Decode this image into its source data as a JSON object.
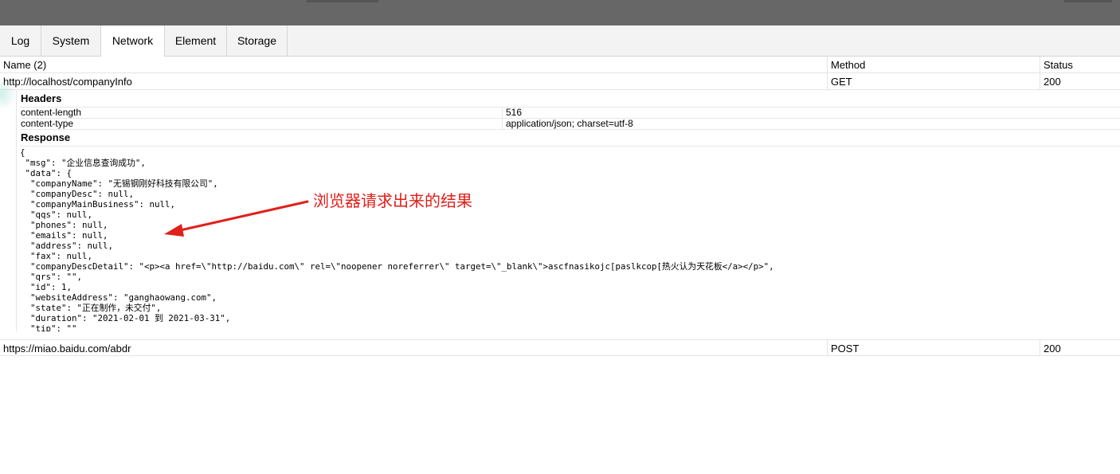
{
  "tabs": [
    {
      "label": "Log"
    },
    {
      "label": "System"
    },
    {
      "label": "Network"
    },
    {
      "label": "Element"
    },
    {
      "label": "Storage"
    }
  ],
  "active_tab": "Network",
  "columns": {
    "name": "Name (2)",
    "method": "Method",
    "status": "Status"
  },
  "requests": [
    {
      "url": "http://localhost/companyInfo",
      "method": "GET",
      "status": "200"
    },
    {
      "url": "https://miao.baidu.com/abdr",
      "method": "POST",
      "status": "200"
    }
  ],
  "details": {
    "headers_title": "Headers",
    "headers": [
      {
        "key": "content-length",
        "value": "516"
      },
      {
        "key": "content-type",
        "value": "application/json; charset=utf-8"
      }
    ],
    "response_title": "Response",
    "response_body": "{\n \"msg\": \"企业信息查询成功\",\n \"data\": {\n  \"companyName\": \"无锡钢刚好科技有限公司\",\n  \"companyDesc\": null,\n  \"companyMainBusiness\": null,\n  \"qqs\": null,\n  \"phones\": null,\n  \"emails\": null,\n  \"address\": null,\n  \"fax\": null,\n  \"companyDescDetail\": \"<p><a href=\\\"http://baidu.com\\\" rel=\\\"noopener noreferrer\\\" target=\\\"_blank\\\">ascfnasikojc[paslkcop[热火认为天花板</a></p>\",\n  \"qrs\": \"\",\n  \"id\": 1,\n  \"websiteAddress\": \"ganghaowang.com\",\n  \"state\": \"正在制作，未交付\",\n  \"duration\": \"2021-02-01 到 2021-03-31\",\n  \"tip\": \"\""
  },
  "annotation": {
    "text": "浏览器请求出来的结果",
    "color": "#e0201b"
  }
}
